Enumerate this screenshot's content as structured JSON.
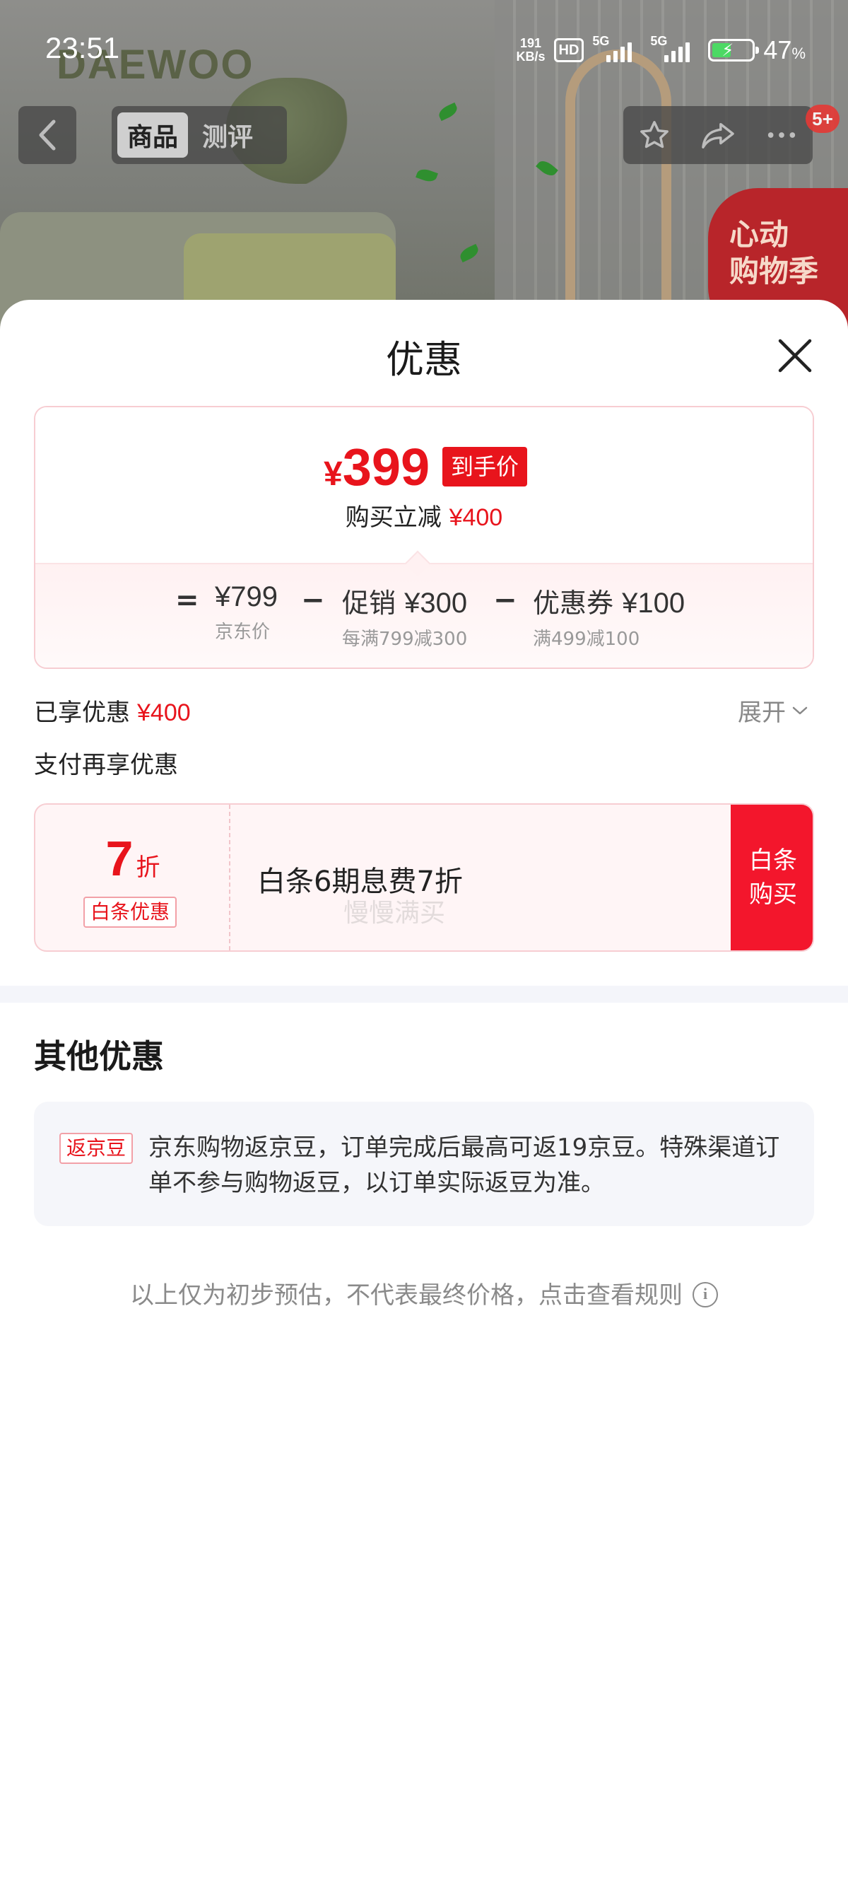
{
  "status_bar": {
    "time": "23:51",
    "net_speed_value": "191",
    "net_speed_unit": "KB/s",
    "hd_label": "HD",
    "sim1": "5G",
    "sim2": "5G",
    "battery_percent": "47",
    "battery_unit": "%"
  },
  "product_page": {
    "brand": "DAEWOO",
    "tabs": [
      {
        "label": "商品",
        "active": true
      },
      {
        "label": "测评",
        "active": false
      }
    ],
    "message_badge": "5+",
    "promo_stamp_line1": "心动",
    "promo_stamp_line2": "购物季"
  },
  "sheet": {
    "title": "优惠",
    "price_summary": {
      "currency": "¥",
      "final_price": "399",
      "final_price_tag": "到手价",
      "instant_discount_label": "购买立减",
      "instant_discount_amount": "¥400",
      "formula": {
        "equals": "=",
        "minus": "−",
        "base": {
          "label": "",
          "amount": "¥799",
          "note": "京东价"
        },
        "promo": {
          "label": "促销",
          "amount": "¥300",
          "note": "每满799减300"
        },
        "coupon": {
          "label": "优惠券",
          "amount": "¥100",
          "note": "满499减100"
        }
      }
    },
    "enjoyed_label": "已享优惠",
    "enjoyed_amount": "¥400",
    "expand_label": "展开",
    "pay_more_label": "支付再享优惠",
    "baitiao": {
      "discount_value": "7",
      "discount_unit": "折",
      "tag": "白条优惠",
      "description": "白条6期息费7折",
      "watermark": "慢慢满买",
      "buy_button_line1": "白条",
      "buy_button_line2": "购买"
    },
    "other_title": "其他优惠",
    "bean_offer": {
      "tag": "返京豆",
      "text": "京东购物返京豆，订单完成后最高可返19京豆。特殊渠道订单不参与购物返豆，以订单实际返豆为准。"
    },
    "disclaimer": "以上仅为初步预估，不代表最终价格，点击查看规则"
  },
  "colors": {
    "accent_red": "#e8141c",
    "buy_red": "#f3162c",
    "card_border": "#f7cdd2"
  }
}
